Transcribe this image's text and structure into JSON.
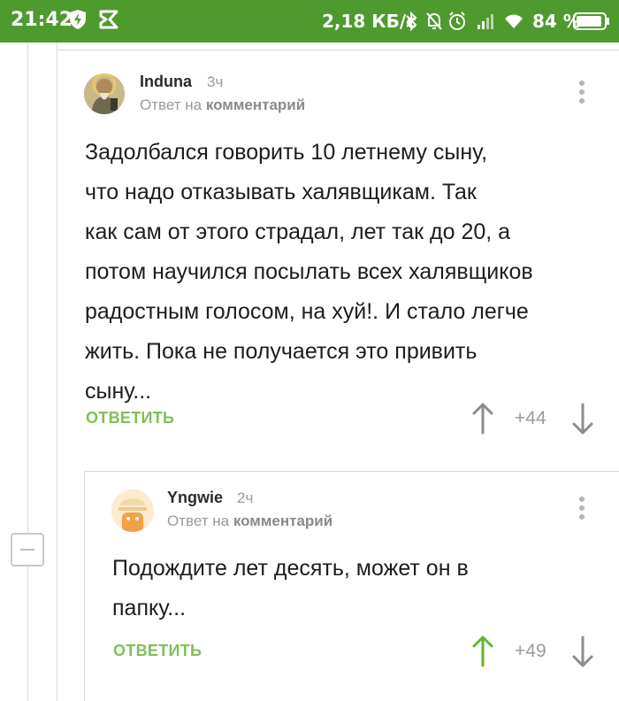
{
  "status_bar": {
    "time": "21:42",
    "network_speed": "2,18 КБ/с",
    "battery": "84 %",
    "colors": {
      "background": "#4f9a2f",
      "foreground": "#ffffff"
    }
  },
  "comments": [
    {
      "author": "Induna",
      "time": "3ч",
      "reply_prefix": "Ответ на",
      "reply_target": "комментарий",
      "text_lines": [
        "Задолбался говорить 10 летнему сыну,",
        "что надо отказывать халявщикам. Так",
        "как сам от этого страдал, лет так до 20, а",
        "потом научился посылать всех халявщиков",
        "радостным голосом, на хуй!. И стало легче",
        "жить. Пока не получается это привить",
        "сыну..."
      ],
      "reply_label": "ОТВЕТИТЬ",
      "score": "+44",
      "upvoted": false
    },
    {
      "author": "Yngwie",
      "time": "2ч",
      "reply_prefix": "Ответ на",
      "reply_target": "комментарий",
      "text_lines": [
        "Подождите лет десять, может он в",
        "папку..."
      ],
      "reply_label": "ОТВЕТИТЬ",
      "score": "+49",
      "upvoted": true
    }
  ],
  "colors": {
    "accent_green": "#7ec05a",
    "upvote_active": "#5cb82e",
    "vote_inactive": "#8d8d8d"
  }
}
